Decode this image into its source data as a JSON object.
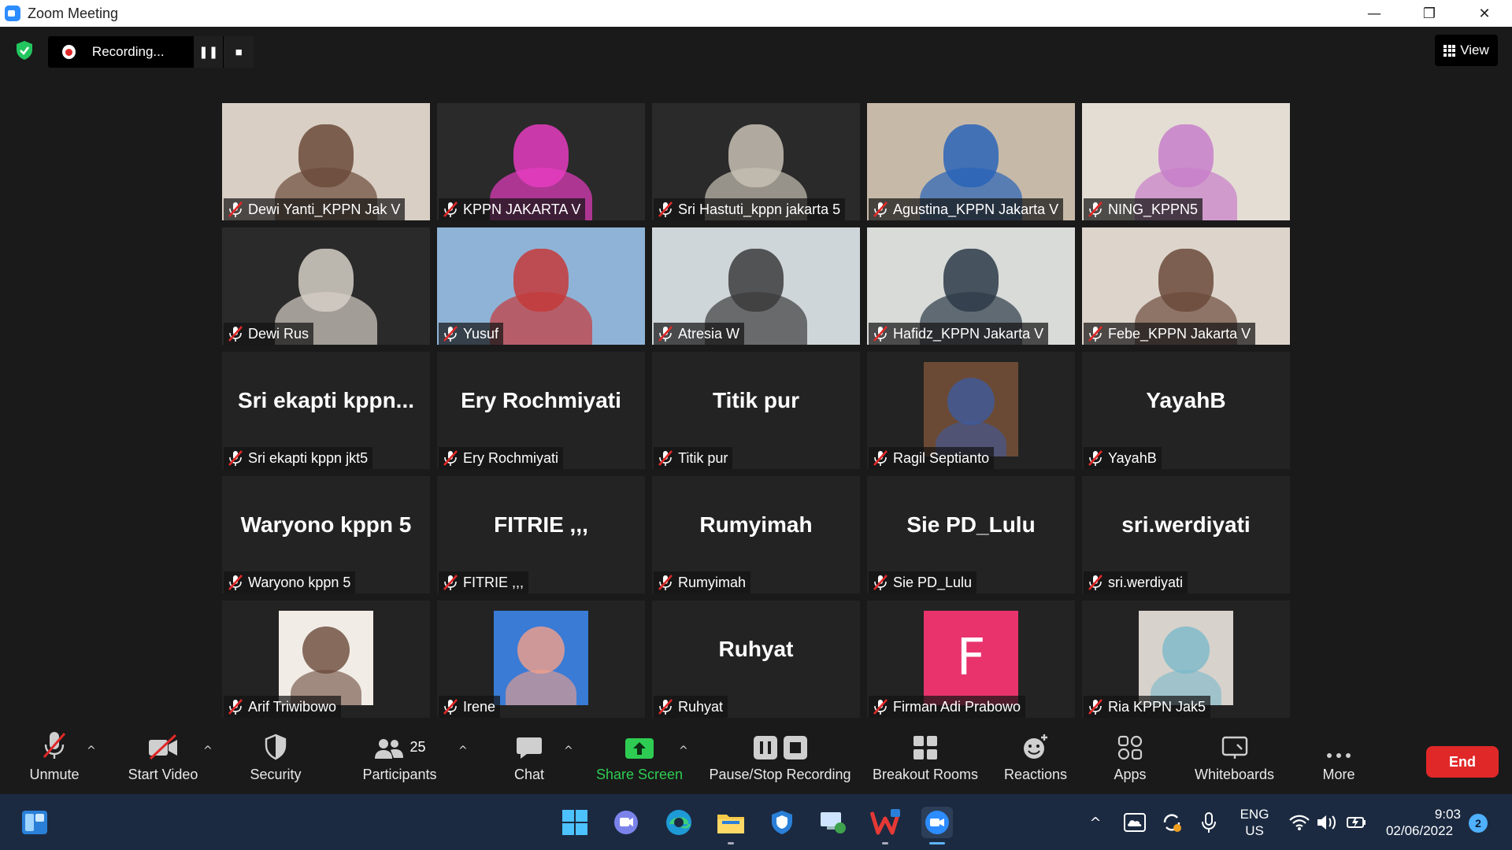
{
  "window": {
    "title": "Zoom Meeting",
    "minimize": "—",
    "restore": "❐",
    "close": "✕"
  },
  "recording": {
    "label": "Recording...",
    "pause": "❚❚",
    "stop": "■"
  },
  "view_button": {
    "label": "View"
  },
  "participants": [
    {
      "name": "Dewi Yanti_KPPN Jak V",
      "type": "video",
      "bg": "#d9cfc4",
      "accent": "#6b4a3a"
    },
    {
      "name": "KPPN JAKARTA V",
      "type": "video",
      "bg": "#2a2a2a",
      "accent": "#e63cc0"
    },
    {
      "name": "Sri Hastuti_kppn jakarta 5",
      "type": "video",
      "bg": "#2a2a2a",
      "accent": "#c8c0b4"
    },
    {
      "name": "Agustina_KPPN Jakarta V",
      "type": "video",
      "bg": "#c7b9a8",
      "accent": "#2a64b8"
    },
    {
      "name": "NING_KPPN5",
      "type": "video",
      "bg": "#e4ddd4",
      "accent": "#c77fc9",
      "active": true
    },
    {
      "name": "Dewi Rus",
      "type": "video",
      "bg": "#2a2a2a",
      "accent": "#d5cfc6"
    },
    {
      "name": "Yusuf",
      "type": "video",
      "bg": "#8fb3d6",
      "accent": "#c43a3a"
    },
    {
      "name": "Atresia W",
      "type": "video",
      "bg": "#cfd6d9",
      "accent": "#3c3c3c"
    },
    {
      "name": "Hafidz_KPPN Jakarta V",
      "type": "video",
      "bg": "#d8dbd8",
      "accent": "#2d3a48"
    },
    {
      "name": "Febe_KPPN Jakarta V",
      "type": "video",
      "bg": "#ddd5cc",
      "accent": "#6b4a3a"
    },
    {
      "name": "Sri ekapti kppn jkt5",
      "type": "name",
      "display": "Sri  ekapti  kppn..."
    },
    {
      "name": "Ery Rochmiyati",
      "type": "name",
      "display": "Ery Rochmiyati"
    },
    {
      "name": "Titik pur",
      "type": "name",
      "display": "Titik pur"
    },
    {
      "name": "Ragil Septianto",
      "type": "photo",
      "bg": "#6b4a35",
      "accent": "#3e5a9c"
    },
    {
      "name": "YayahB",
      "type": "name",
      "display": "YayahB"
    },
    {
      "name": "Waryono kppn 5",
      "type": "name",
      "display": "Waryono kppn 5"
    },
    {
      "name": "FITRIE ,,,",
      "type": "name",
      "display": "FITRIE ,,,"
    },
    {
      "name": "Rumyimah",
      "type": "name",
      "display": "Rumyimah"
    },
    {
      "name": "Sie PD_Lulu",
      "type": "name",
      "display": "Sie PD_Lulu"
    },
    {
      "name": "sri.werdiyati",
      "type": "name",
      "display": "sri.werdiyati"
    },
    {
      "name": "Arif Triwibowo",
      "type": "photo",
      "bg": "#f1ece6",
      "accent": "#6b4a3a"
    },
    {
      "name": "Irene",
      "type": "photo",
      "bg": "#3a7bd5",
      "accent": "#f4a08a"
    },
    {
      "name": "Ruhyat",
      "type": "name",
      "display": "Ruhyat"
    },
    {
      "name": "Firman Adi Prabowo",
      "type": "letter",
      "letter": "F",
      "bg": "#e8336d"
    },
    {
      "name": "Ria KPPN Jak5",
      "type": "photo",
      "bg": "#d7d2cc",
      "accent": "#7bb9c9"
    }
  ],
  "toolbar": {
    "unmute": "Unmute",
    "start_video": "Start Video",
    "security": "Security",
    "participants": "Participants",
    "participants_count": "25",
    "chat": "Chat",
    "share_screen": "Share Screen",
    "pause_stop": "Pause/Stop Recording",
    "breakout": "Breakout Rooms",
    "reactions": "Reactions",
    "apps": "Apps",
    "whiteboards": "Whiteboards",
    "more": "More",
    "end": "End"
  },
  "taskbar": {
    "language_top": "ENG",
    "language_bottom": "US",
    "time": "9:03",
    "date": "02/06/2022",
    "notifications": "2"
  },
  "colors": {
    "accent_green": "#2ecc52",
    "end_red": "#e02828",
    "active_speaker": "#d5f75b",
    "zoom_blue": "#2d8cff"
  }
}
